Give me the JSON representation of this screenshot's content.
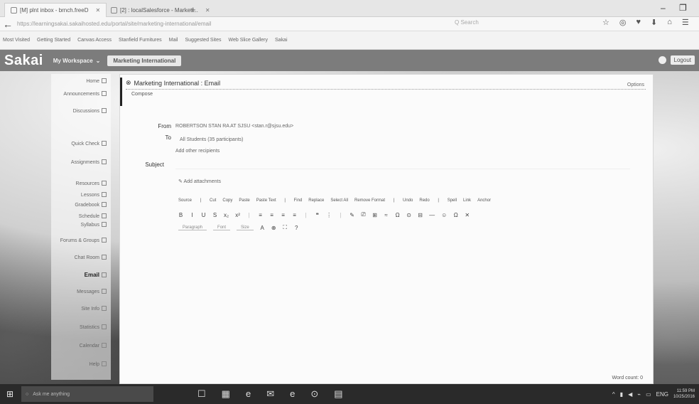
{
  "browser": {
    "tabs": [
      {
        "label": "[M] plnt inbox - brnch.freeD"
      },
      {
        "label": "[2] : localSalesforce - Marketi..."
      }
    ],
    "new_tab_glyph": "+",
    "minimize_glyph": "–",
    "restore_glyph": "❐",
    "address": "https://learningsakai.sakaihosted.edu/portal/site/marketing-international/email",
    "search_placeholder": "Q Search",
    "toolbar_icons": [
      "star-icon",
      "reading-list-icon",
      "pocket-icon",
      "download-icon",
      "home-icon",
      "menu-icon"
    ],
    "bookmarks": [
      "Most Visited",
      "Getting Started",
      "Canvas Access",
      "Stanfield Furnitures",
      "Mail",
      "Suggested Sites",
      "Web Slice Gallery",
      "Sakai"
    ]
  },
  "sakai": {
    "logo": "Sakai",
    "site_dropdown": "My Workspace",
    "current_site": "Marketing International",
    "logout": "Logout"
  },
  "tools": [
    "Home",
    "Announcements",
    "Discussions",
    "Quick Check",
    "Assignments",
    "Resources",
    "Lessons",
    "Gradebook",
    "Schedule",
    "Syllabus",
    "Forums & Groups",
    "Chat Room",
    "Email",
    "Messages",
    "Site Info",
    "Statistics",
    "Calendar",
    "Help"
  ],
  "current_tool": "Email",
  "email": {
    "title": "Marketing International : Email",
    "link": "Options",
    "crumb": "Compose",
    "from_label": "From",
    "from_value": "ROBERTSON STAN RA AT SJSU <stan.r@sjsu.edu>",
    "to_label": "To",
    "to_value": "All Students (35 participants)",
    "to_sub": "Add other recipients",
    "subject_label": "Subject",
    "attach": "Add attachments",
    "word_count": "Word count: 0",
    "toolbar_row1": [
      "Source",
      "|",
      "Cut",
      "Copy",
      "Paste",
      "Paste Text",
      "|",
      "Find",
      "Replace",
      "Select All",
      "Remove Format",
      "|",
      "Undo",
      "Redo",
      "|",
      "Spell",
      "Link",
      "Anchor"
    ],
    "toolbar_row2": [
      "B",
      "I",
      "U",
      "S",
      "x₂",
      "x²",
      "|",
      "≡",
      "≡",
      "≡",
      "≡",
      "|",
      "❝",
      "⋮",
      "|",
      "✎",
      "⎚",
      "⊞",
      "≈",
      "Ω",
      "⊙",
      "⊟",
      "—",
      "☺",
      "Ω",
      "✕"
    ],
    "toolbar_row3_selects": [
      "Paragraph",
      "Font",
      "Size"
    ],
    "toolbar_row3_icons": [
      "A",
      "⊕",
      "⛶",
      "?"
    ]
  },
  "taskbar": {
    "start": "⊞",
    "search_placeholder": "Ask me anything",
    "apps": [
      "☐",
      "▦",
      "e",
      "✉",
      "e",
      "⊙",
      "▤"
    ],
    "tray": [
      "^",
      "▮",
      "◀",
      "⌁",
      "▭",
      "ENG"
    ],
    "time": "11:59 PM",
    "date": "10/25/2016"
  }
}
